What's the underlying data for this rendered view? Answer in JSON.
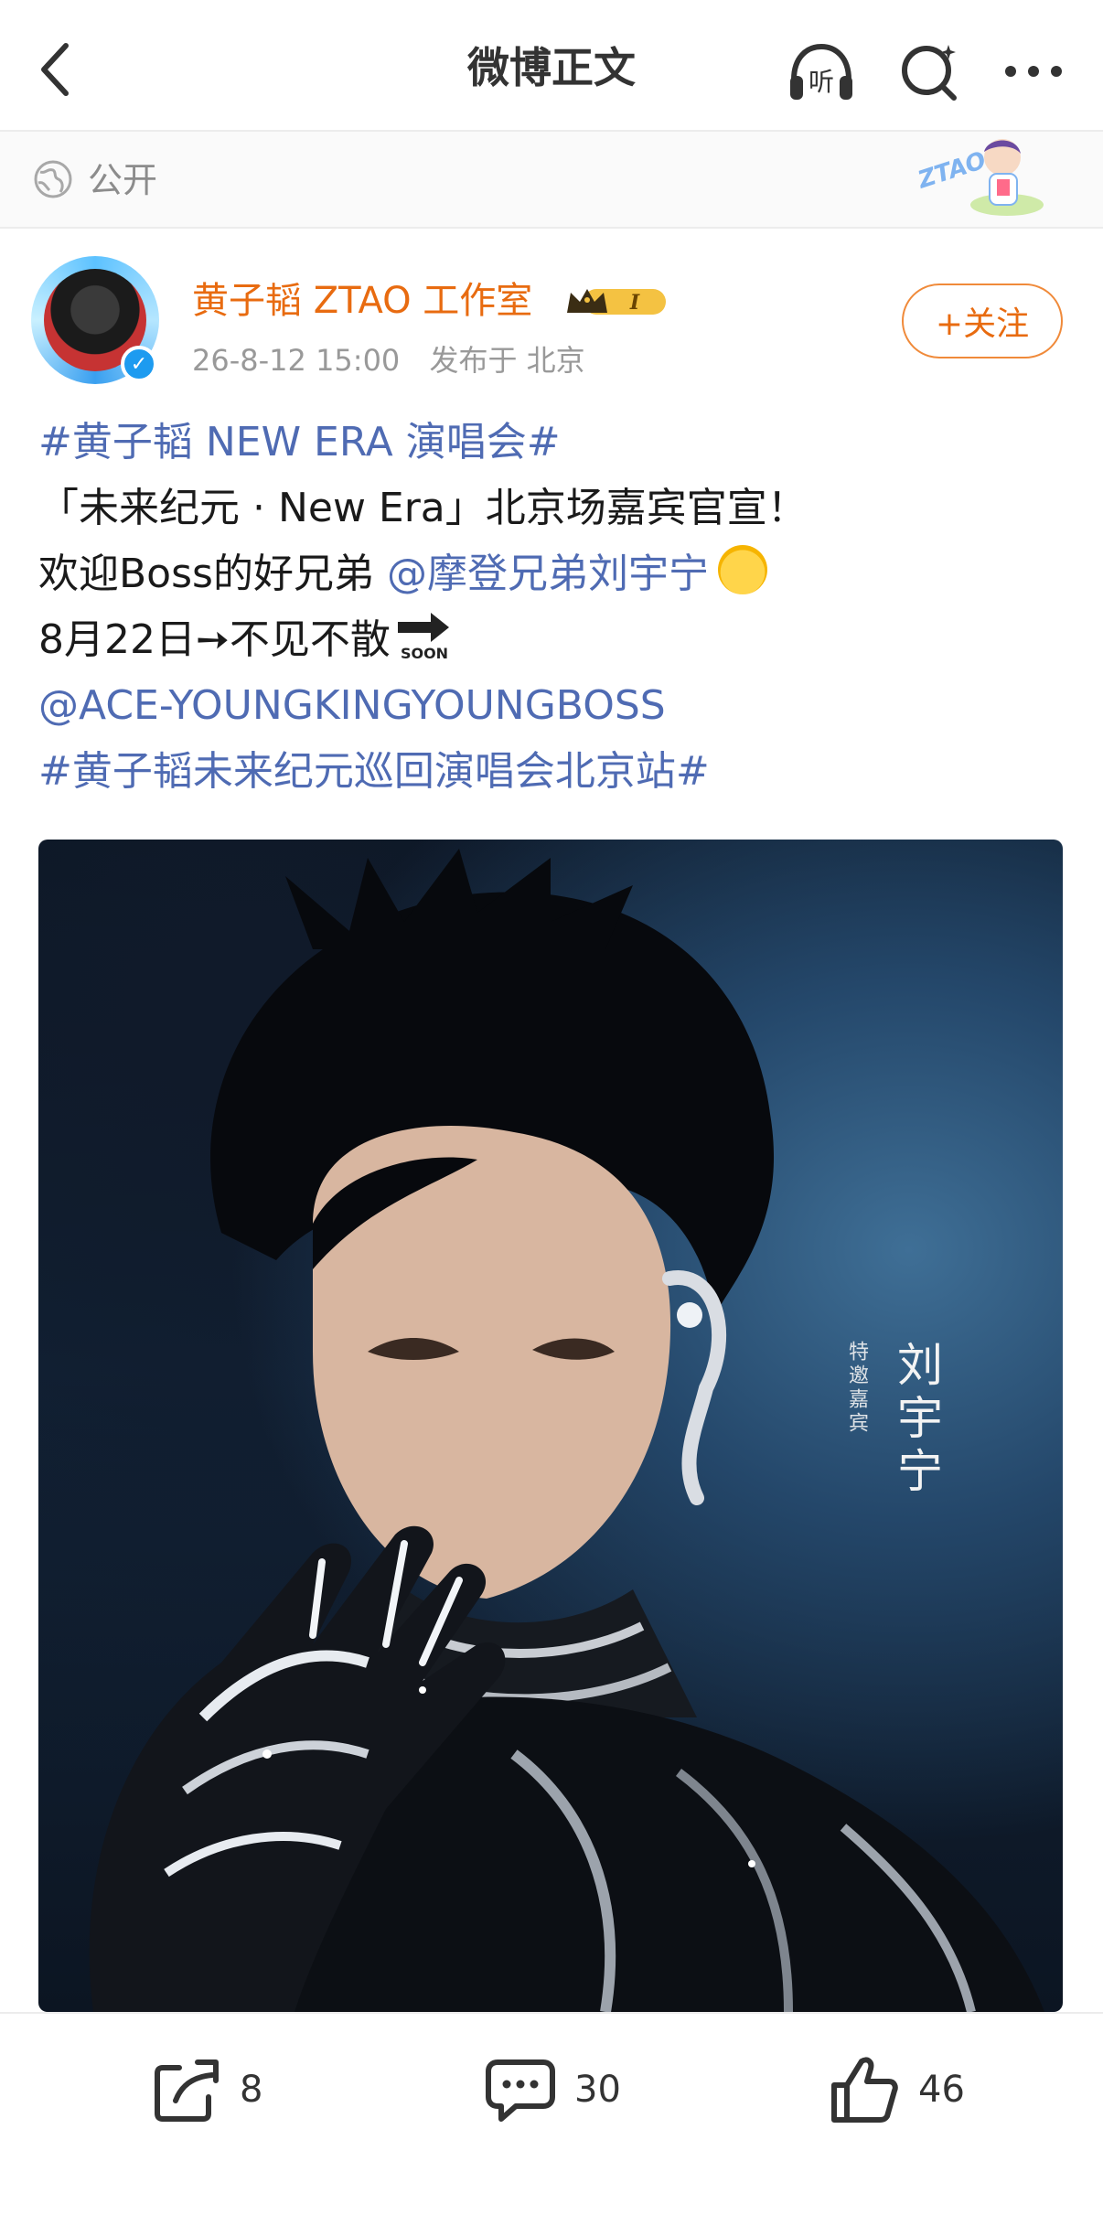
{
  "nav": {
    "title": "微博正文",
    "listen_label": "听"
  },
  "visibility": {
    "label": "公开"
  },
  "post": {
    "author": "黄子韬 ZTAO 工作室",
    "badge_level": "I",
    "time": "26-8-12 15:00",
    "location": "发布于 北京",
    "follow_label": "+关注",
    "lines": {
      "l1": "#黄子韬 NEW ERA 演唱会#",
      "l2": "「未来纪元 · New Era」北京场嘉宾官宣！",
      "l3_prefix": "欢迎Boss的好兄弟 ",
      "l3_mention": "@摩登兄弟刘宇宁",
      "l4": "8月22日➙不见不散",
      "l4_soon": "SOON",
      "l5": "@ACE-YOUNGKINGYOUNGBOSS",
      "l6": "#黄子韬未来纪元巡回演唱会北京站#"
    },
    "image": {
      "caption_small": "特邀嘉宾",
      "caption_name": "刘宇宁"
    }
  },
  "toolbar": {
    "share_count": "8",
    "comment_count": "30",
    "like_count": "46"
  },
  "colors": {
    "accent_orange": "#e86b10",
    "link_blue": "#4f6bb3",
    "verify_blue": "#1d9bf0"
  }
}
